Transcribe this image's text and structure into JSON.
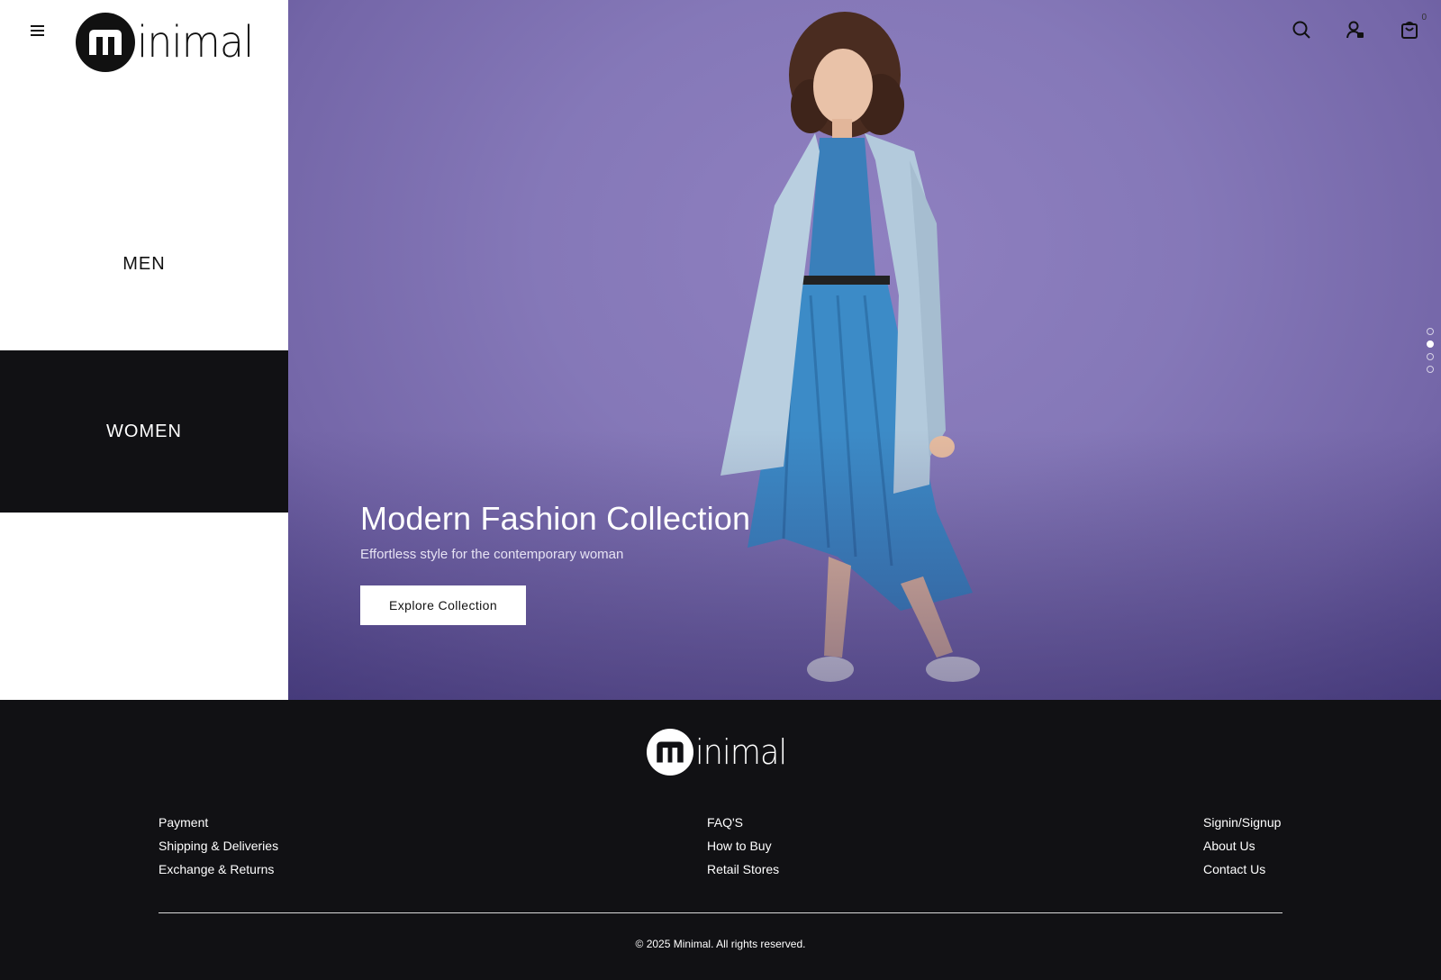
{
  "brand": {
    "logo_letter": "m",
    "logo_word": "inimal"
  },
  "nav": {
    "categories": [
      {
        "label": "MEN",
        "active": false
      },
      {
        "label": "WOMEN",
        "active": true
      }
    ]
  },
  "header_icons": [
    "search-icon",
    "user-icon",
    "cart-icon"
  ],
  "cart": {
    "count": "0"
  },
  "hero": {
    "title": "Modern Fashion Collection",
    "subtitle": "Effortless style for the contemporary woman",
    "cta_label": "Explore Collection",
    "slide_count": 4,
    "active_slide": 2
  },
  "footer": {
    "columns": [
      [
        "Payment",
        "Shipping & Deliveries",
        "Exchange & Returns"
      ],
      [
        "FAQ'S",
        "How to Buy",
        "Retail Stores"
      ],
      [
        "Signin/Signup",
        "About Us",
        "Contact Us"
      ]
    ],
    "copyright": "© 2025 Minimal. All rights reserved."
  },
  "colors": {
    "hero_bg": "#8578b8",
    "dark": "#111114",
    "white": "#ffffff"
  }
}
